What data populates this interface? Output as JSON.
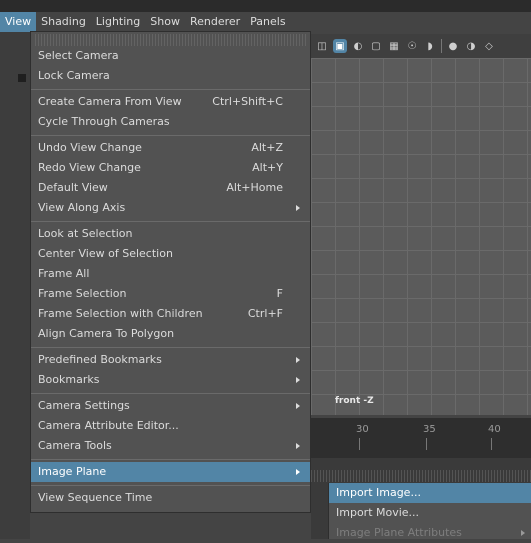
{
  "menubar": [
    "View",
    "Shading",
    "Lighting",
    "Show",
    "Renderer",
    "Panels"
  ],
  "viewport": {
    "camera_label": "front -Z",
    "timeline_ticks": [
      "30",
      "35",
      "40"
    ]
  },
  "view_menu": {
    "groups": [
      [
        {
          "label": "Select Camera",
          "shortcut": "",
          "submenu": false
        },
        {
          "label": "Lock Camera",
          "shortcut": "",
          "submenu": false
        }
      ],
      [
        {
          "label": "Create Camera From View",
          "shortcut": "Ctrl+Shift+C",
          "submenu": false
        },
        {
          "label": "Cycle Through Cameras",
          "shortcut": "",
          "submenu": false
        }
      ],
      [
        {
          "label": "Undo View Change",
          "shortcut": "Alt+Z",
          "submenu": false
        },
        {
          "label": "Redo View Change",
          "shortcut": "Alt+Y",
          "submenu": false
        },
        {
          "label": "Default View",
          "shortcut": "Alt+Home",
          "submenu": false
        },
        {
          "label": "View Along Axis",
          "shortcut": "",
          "submenu": true
        }
      ],
      [
        {
          "label": "Look at Selection",
          "shortcut": "",
          "submenu": false
        },
        {
          "label": "Center View of Selection",
          "shortcut": "",
          "submenu": false
        },
        {
          "label": "Frame All",
          "shortcut": "",
          "submenu": false
        },
        {
          "label": "Frame Selection",
          "shortcut": "F",
          "submenu": false
        },
        {
          "label": "Frame Selection with Children",
          "shortcut": "Ctrl+F",
          "submenu": false
        },
        {
          "label": "Align Camera To Polygon",
          "shortcut": "",
          "submenu": false
        }
      ],
      [
        {
          "label": "Predefined Bookmarks",
          "shortcut": "",
          "submenu": true
        },
        {
          "label": "Bookmarks",
          "shortcut": "",
          "submenu": true
        }
      ],
      [
        {
          "label": "Camera Settings",
          "shortcut": "",
          "submenu": true
        },
        {
          "label": "Camera Attribute Editor...",
          "shortcut": "",
          "submenu": false
        },
        {
          "label": "Camera Tools",
          "shortcut": "",
          "submenu": true
        }
      ],
      [
        {
          "label": "Image Plane",
          "shortcut": "",
          "submenu": true,
          "highlighted": true
        }
      ],
      [
        {
          "label": "View Sequence Time",
          "shortcut": "",
          "submenu": false
        }
      ]
    ]
  },
  "image_plane_submenu": [
    {
      "label": "Import Image...",
      "highlighted": true
    },
    {
      "label": "Import Movie..."
    },
    {
      "label": "Image Plane Attributes",
      "disabled": true,
      "submenu": true
    }
  ],
  "toolbar_icons": [
    "camera-icon",
    "cube-shaded-icon",
    "sphere-half-icon",
    "cube-wire-icon",
    "grid-icon",
    "light-icon",
    "shadow-icon",
    "sphere-icon",
    "material-icon",
    "isolate-icon"
  ],
  "colors": {
    "accent": "#5285a6",
    "menu_bg": "#525252",
    "viewport_bg": "#5b5b5b"
  }
}
